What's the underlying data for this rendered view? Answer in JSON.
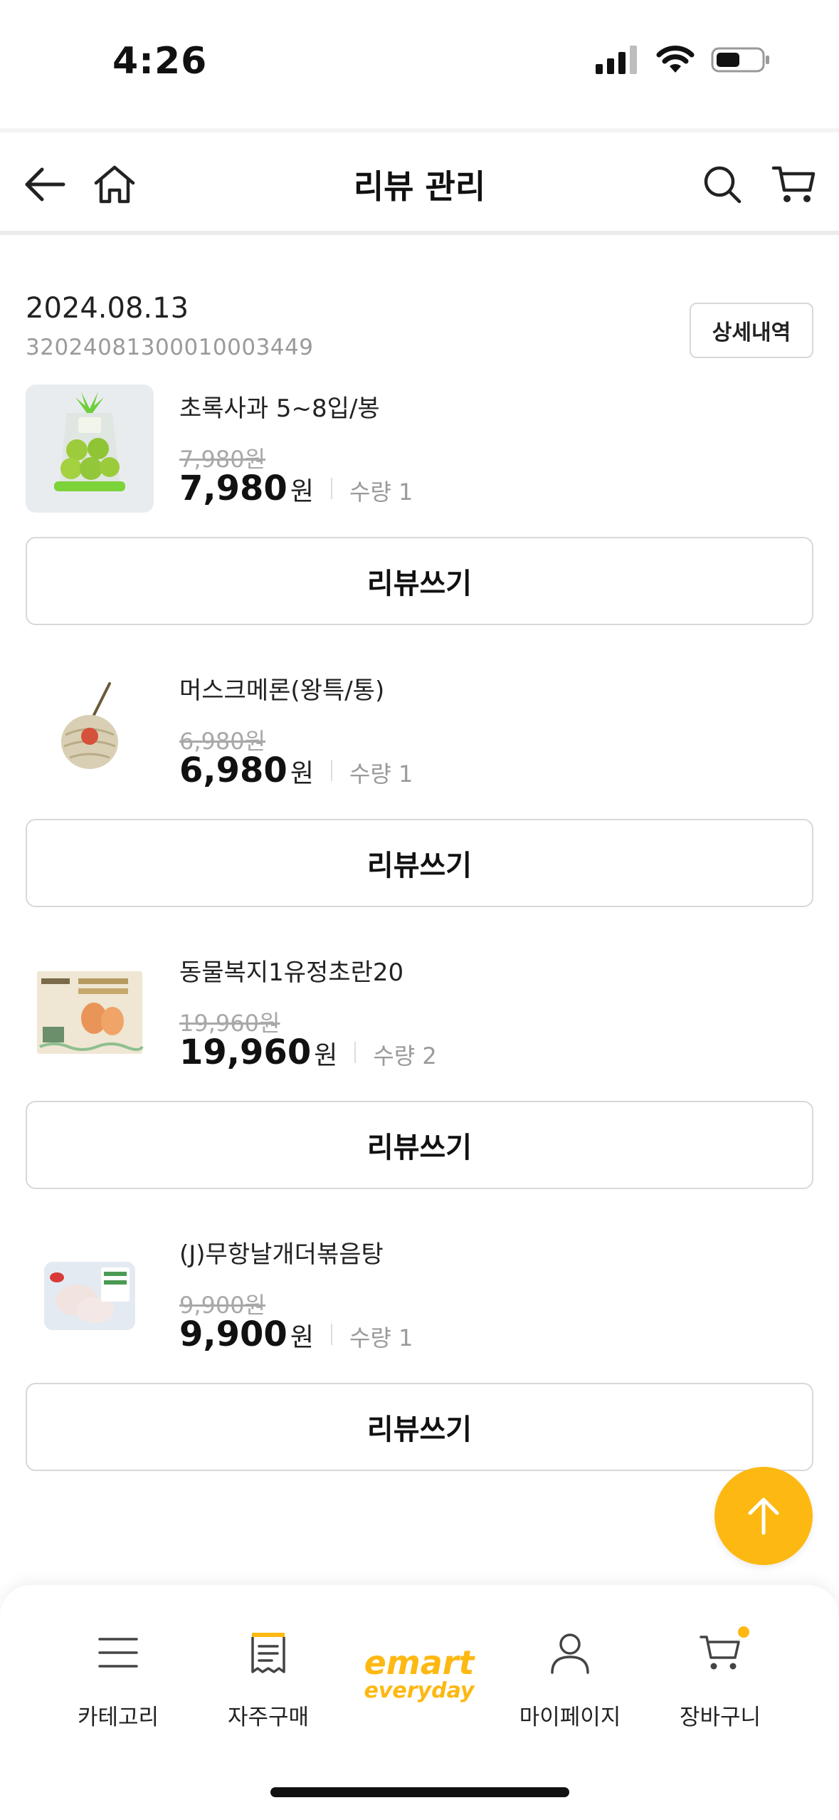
{
  "status_bar": {
    "time": "4:26"
  },
  "header": {
    "title": "리뷰 관리"
  },
  "order": {
    "date": "2024.08.13",
    "number": "32024081300010003449",
    "detail_label": "상세내역"
  },
  "products": [
    {
      "name": "초록사과 5~8입/봉",
      "original_price": "7,980원",
      "price": "7,980",
      "unit": "원",
      "qty": "수량 1",
      "review_label": "리뷰쓰기",
      "image": "green-apple-bag"
    },
    {
      "name": "머스크메론(왕특/통)",
      "original_price": "6,980원",
      "price": "6,980",
      "unit": "원",
      "qty": "수량 1",
      "review_label": "리뷰쓰기",
      "image": "musk-melon"
    },
    {
      "name": "동물복지1유정초란20",
      "original_price": "19,960원",
      "price": "19,960",
      "unit": "원",
      "qty": "수량 2",
      "review_label": "리뷰쓰기",
      "image": "egg-carton"
    },
    {
      "name": "(J)무항날개더볶음탕",
      "original_price": "9,900원",
      "price": "9,900",
      "unit": "원",
      "qty": "수량 1",
      "review_label": "리뷰쓰기",
      "image": "chicken-pack"
    }
  ],
  "bottom_nav": {
    "items": [
      {
        "label": "카테고리",
        "icon": "menu-icon"
      },
      {
        "label": "자주구매",
        "icon": "receipt-icon"
      },
      {
        "label": "emart",
        "sublabel": "everyday",
        "icon": "emart-logo"
      },
      {
        "label": "마이페이지",
        "icon": "person-icon"
      },
      {
        "label": "장바구니",
        "icon": "cart-icon"
      }
    ]
  },
  "colors": {
    "accent": "#fdb812",
    "border": "#d8d8d8",
    "muted": "#9a9a9a"
  }
}
